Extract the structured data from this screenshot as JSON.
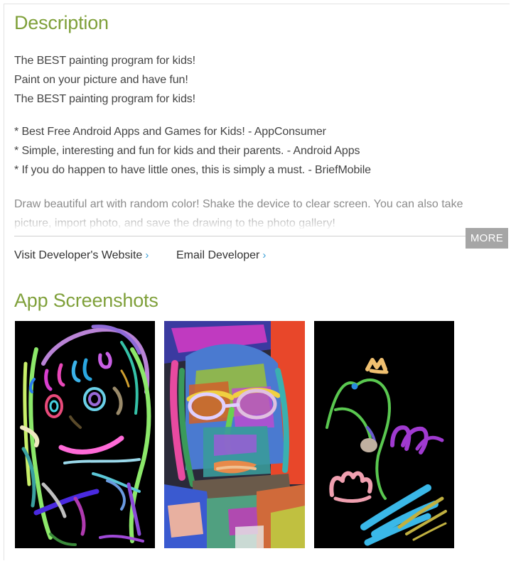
{
  "description": {
    "title": "Description",
    "lines": [
      "The BEST painting program for kids!",
      "Paint on your picture and have fun!",
      "The BEST painting program for kids!"
    ],
    "quotes": [
      "* Best Free Android Apps and Games for Kids! - AppConsumer",
      "* Simple, interesting and fun for kids and their parents. - Android Apps",
      "* If you do happen to have little ones, this is simply a must. - BriefMobile"
    ],
    "body_lines": [
      "Draw beautiful art with random color! Shake the device to clear screen. You can also take",
      "picture, import photo, and save the drawing to the photo gallery!"
    ],
    "more_label": "MORE"
  },
  "developer": {
    "website_label": "Visit Developer's Website",
    "email_label": "Email Developer",
    "chevron": "›"
  },
  "screenshots": {
    "title": "App Screenshots",
    "items": [
      "screenshot-scribble-girl",
      "screenshot-colorful-portrait",
      "screenshot-swan-drawing"
    ]
  },
  "colors": {
    "heading_green": "#7fa03a",
    "link_blue": "#3a9fd6",
    "more_button_gray": "#a6a6a6"
  }
}
